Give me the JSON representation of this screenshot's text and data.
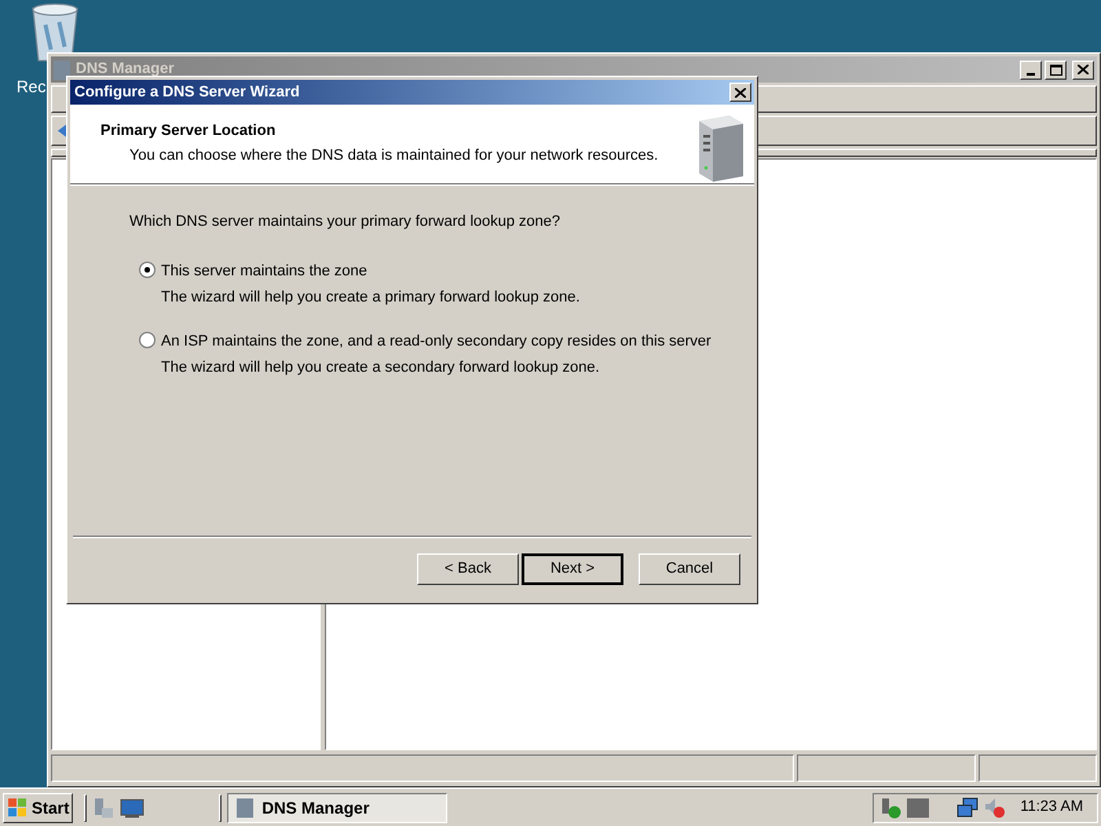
{
  "desktop": {
    "icons": [
      {
        "label": "Rec"
      }
    ]
  },
  "background_window": {
    "title": "DNS Manager"
  },
  "dialog": {
    "title": "Configure a DNS Server Wizard",
    "header": {
      "title": "Primary Server Location",
      "subtitle": "You can choose where the DNS data is maintained for your network resources."
    },
    "question": "Which DNS server maintains your primary forward lookup zone?",
    "options": [
      {
        "label": "This server maintains the zone",
        "description": "The wizard will help you create a primary forward lookup zone.",
        "selected": true
      },
      {
        "label": "An ISP maintains the zone, and a read-only secondary copy resides on this server",
        "description": "The wizard will help you create a secondary forward lookup zone.",
        "selected": false
      }
    ],
    "buttons": [
      {
        "label": "< Back",
        "default": false
      },
      {
        "label": "Next >",
        "default": true
      },
      {
        "label": "Cancel",
        "default": false
      }
    ]
  },
  "taskbar": {
    "start": "Start",
    "tasks": [
      {
        "label": "DNS Manager",
        "selected": true
      }
    ],
    "clock": "11:23 AM"
  }
}
